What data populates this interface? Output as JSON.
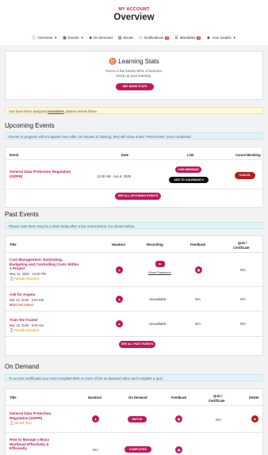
{
  "header": {
    "crumb": "MY ACCOUNT",
    "title": "Overview",
    "nav": [
      {
        "icon": "info-icon",
        "label": "Overview",
        "caret": "▼"
      },
      {
        "icon": "calendar-icon",
        "label": "Events",
        "caret": "▼"
      },
      {
        "icon": "video-icon",
        "label": "On Demand"
      },
      {
        "icon": "book-icon",
        "label": "Books"
      },
      {
        "icon": "chat-icon",
        "label": "Notifications",
        "badge": "1"
      },
      {
        "icon": "list-icon",
        "label": "Mandates",
        "badge": "1"
      },
      {
        "icon": "user-icon",
        "label": "Your Details",
        "caret": "▼"
      }
    ]
  },
  "stats": {
    "title": "Learning Stats",
    "line1": "You're in the bottom 90% of learners.",
    "line2": "Keep up your learning.",
    "button": "SEE MORE STATS"
  },
  "mandates_notice": {
    "pre": "You have been assigned ",
    "link": "mandates",
    "post": ", please review these."
  },
  "upcoming": {
    "title": "Upcoming Events",
    "notice": "Events in progress will not appear here after 15 minutes of starting, they will show under 'Past Events' once completed.",
    "headers": [
      "Event",
      "Date",
      "Link",
      "Cancel Booking"
    ],
    "rows": [
      {
        "event_line1": "General Data Protection Regulation",
        "event_line2": "(GDPR)",
        "date": "11:00 AM - Jun 6, 2025",
        "join": "JOIN WEBINAR",
        "calendar": "ADD TO CALENDAR ▾",
        "cancel": "CANCEL"
      }
    ],
    "see_all": "SEE ALL UPCOMING EVENTS"
  },
  "past": {
    "title": "Past Events",
    "notice": "Please note there may be a short delay after a live event before it is shown below.",
    "headers": [
      "Title",
      "Handout",
      "Recording",
      "Feedback",
      "Quiz /",
      "Certificate"
    ],
    "rows": [
      {
        "title_lines": [
          "Cost Management: Estimating,",
          "Budgeting and Controlling Costs Within",
          "a Project"
        ],
        "date": "May 13, 2025 - 12:00 PM",
        "status": "Partially Attended",
        "recording_link": "Show Password",
        "quiz": "N/A"
      },
      {
        "title_lines": [
          "Ask for Angela"
        ],
        "date": "Mar 20, 2025 - 2:00 PM",
        "status": "Did Not Attend",
        "recording": "Unavailable",
        "feedback": "N/A",
        "quiz": "N/A"
      },
      {
        "title_lines": [
          "Train the Trainer"
        ],
        "date": "Mar 19, 2025 - 9:00 AM",
        "status": "Partially Attended",
        "recording": "Unavailable",
        "feedback": "N/A",
        "quiz": "N/A"
      }
    ],
    "see_all": "SEE ALL PAST EVENTS"
  },
  "ondemand": {
    "title": "On Demand",
    "notice": "To access certificates you must complete 80% or more of the on demand video and complete a quiz.",
    "headers": [
      "Title",
      "Handout",
      "On Demand",
      "Feedback",
      "Quiz /",
      "Certificate",
      "Delete"
    ],
    "rows": [
      {
        "title_lines": [
          "General Data Protection",
          "Regulation (GDPR)"
        ],
        "status": "Started (3%)",
        "button": "WATCH",
        "quiz": "N/A"
      },
      {
        "title_lines": [
          "How to Manage a Busy",
          "Workload Effectively &",
          "Efficiently"
        ],
        "handout": "N/A",
        "button": "COMPLETED"
      }
    ]
  },
  "colors": {
    "accent": "#c2185b",
    "cancel": "#b71c1c",
    "notice_yellow": "#fff7d6",
    "notice_blue": "#e2f3f7"
  }
}
